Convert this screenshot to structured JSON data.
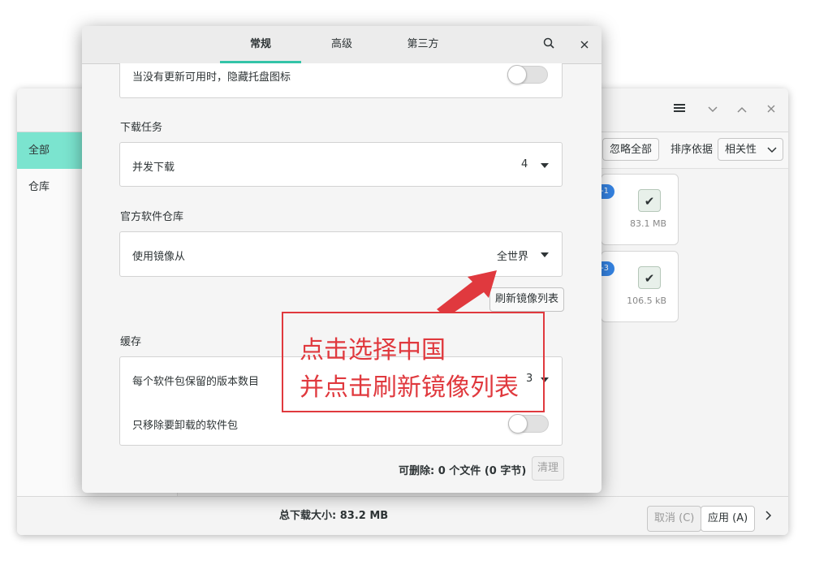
{
  "background_window": {
    "sidebar": {
      "items": [
        {
          "label": "全部",
          "active": true
        },
        {
          "label": "仓库",
          "active": false
        }
      ]
    },
    "toolbar": {
      "ignore_all_label": "忽略全部",
      "sort_label": "排序依据",
      "sort_value": "相关性"
    },
    "cards": [
      {
        "badge": "-1",
        "size": "83.1 MB"
      },
      {
        "badge": "-3",
        "size": "106.5 kB"
      }
    ],
    "footer": {
      "total": "总下载大小: 83.2 MB",
      "cancel_label": "取消 (C)",
      "apply_label": "应用 (A)"
    }
  },
  "dialog": {
    "tabs": [
      {
        "label": "常规",
        "active": true
      },
      {
        "label": "高级",
        "active": false
      },
      {
        "label": "第三方",
        "active": false
      }
    ],
    "hide_tray": {
      "label": "当没有更新可用时，隐藏托盘图标",
      "enabled": false
    },
    "download": {
      "section": "下载任务",
      "label": "并发下载",
      "value": "4"
    },
    "repo": {
      "section": "官方软件仓库",
      "label": "使用镜像从",
      "value": "全世界",
      "refresh_label": "刷新镜像列表"
    },
    "cache": {
      "section": "缓存",
      "keep_label": "每个软件包保留的版本数目",
      "keep_value": "3",
      "remove_label": "只移除要卸载的软件包",
      "remove_enabled": false
    },
    "footer": {
      "info": "可删除:  0 个文件  (0 字节)",
      "clean_label": "清理"
    }
  },
  "annotation": {
    "line1": "点击选择中国",
    "line2": "并点击刷新镜像列表",
    "color": "#e0393e"
  },
  "colors": {
    "accent": "#33c4a8",
    "sidebar_active": "#7be4cf",
    "badge": "#3584e4"
  }
}
